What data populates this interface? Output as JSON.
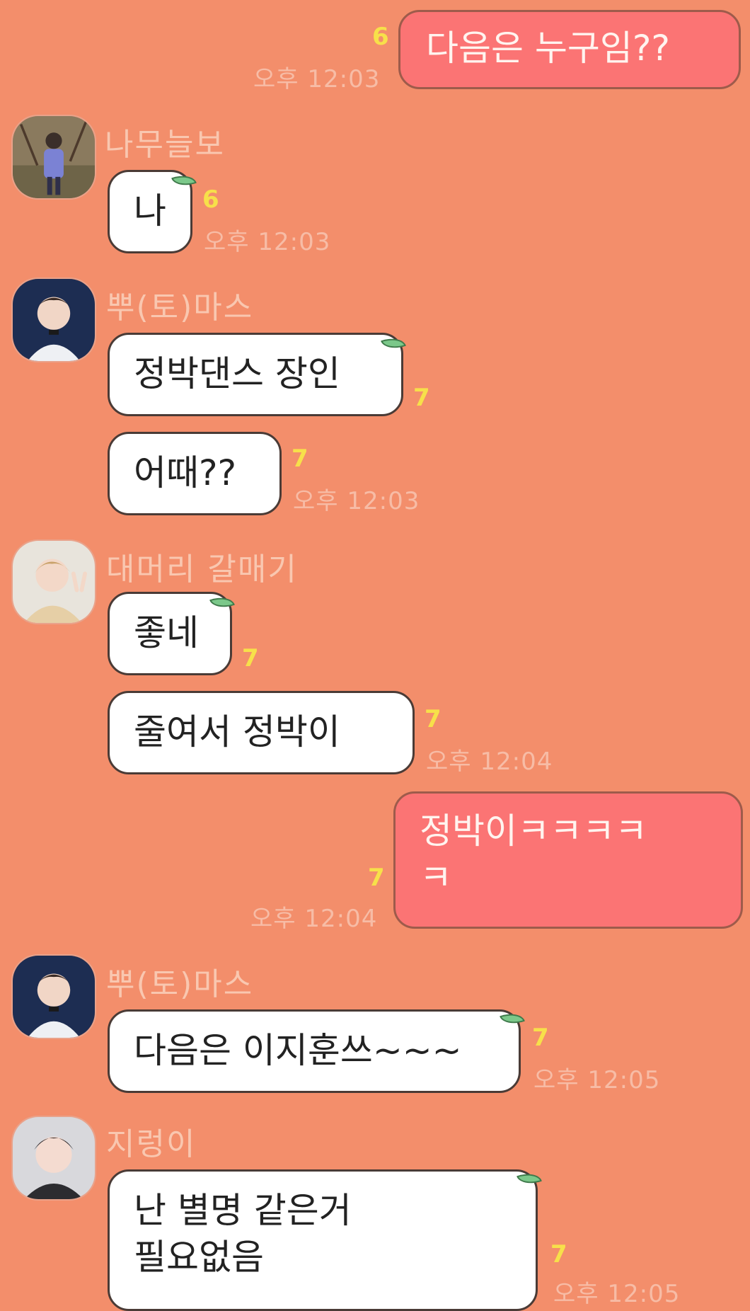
{
  "messages": [
    {
      "sender": "",
      "text": "다음은 누구임??",
      "count": "6",
      "time": "오후 12:03",
      "mine": true
    },
    {
      "sender": "나무늘보",
      "text": "나",
      "count": "6",
      "time": "오후 12:03"
    },
    {
      "sender": "뿌(토)마스",
      "text": "정박댄스 장인",
      "count": "7"
    },
    {
      "text": "어때??",
      "count": "7",
      "time": "오후 12:03"
    },
    {
      "sender": "대머리 갈매기",
      "text": "좋네",
      "count": "7"
    },
    {
      "text": "줄여서 정박이",
      "count": "7",
      "time": "오후 12:04"
    },
    {
      "sender": "",
      "text": "정박이ㅋㅋㅋㅋ\nㅋ",
      "count": "7",
      "time": "오후 12:04",
      "mine": true
    },
    {
      "sender": "뿌(토)마스",
      "text": "다음은 이지훈쓰~~~",
      "count": "7",
      "time": "오후 12:05"
    },
    {
      "sender": "지렁이",
      "text": "난 별명 같은거\n필요없음",
      "count": "7",
      "time": "오후 12:05"
    }
  ],
  "colors": {
    "background": "#f38e6b",
    "my_bubble": "#fb7474",
    "other_bubble": "#ffffff"
  }
}
